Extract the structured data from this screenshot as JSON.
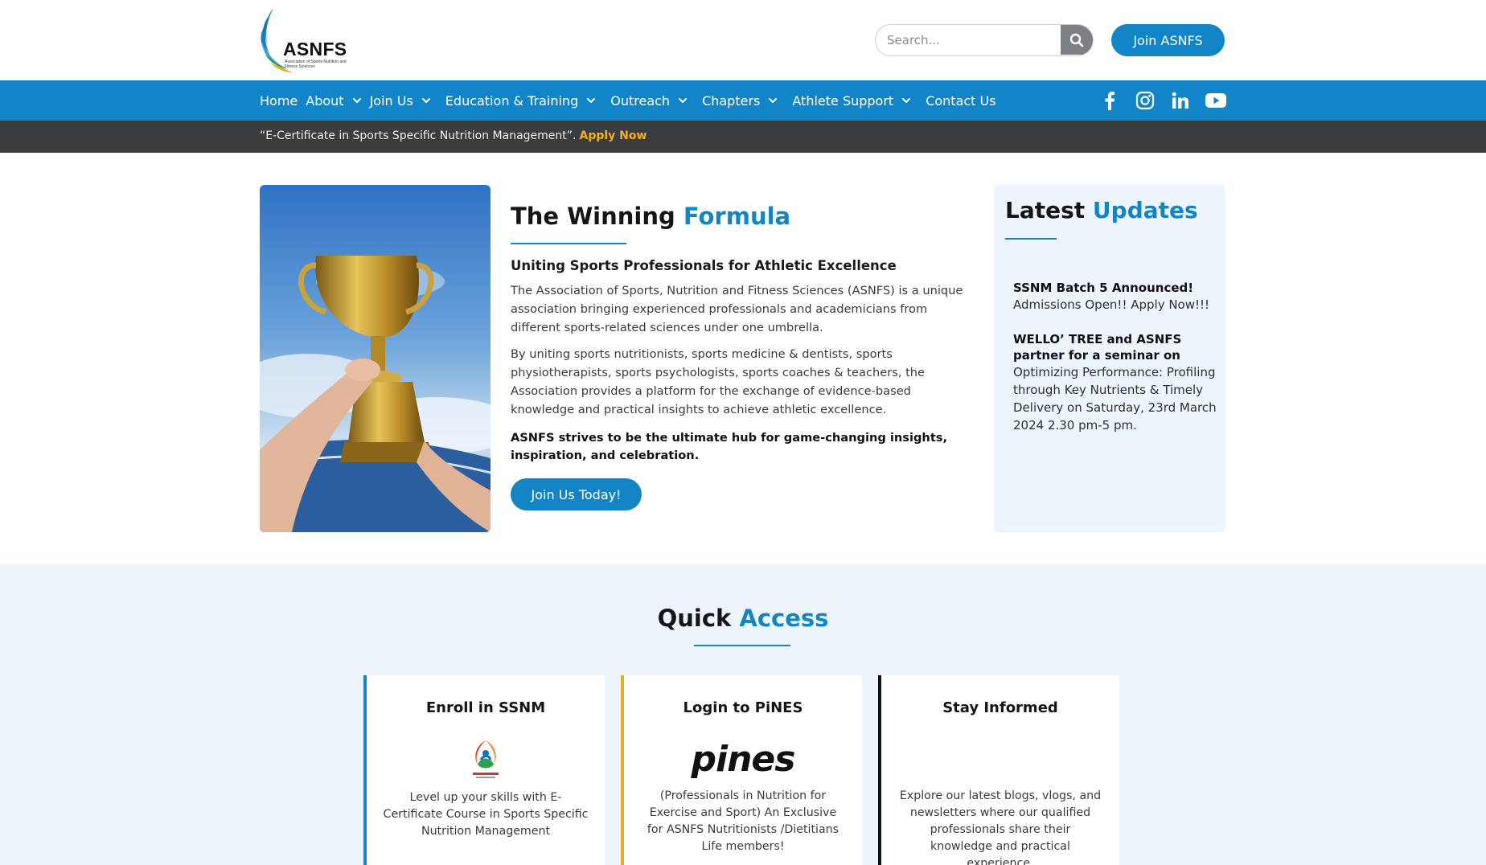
{
  "header": {
    "logo_text": "ASNFS",
    "logo_subtext": "Association of Sports Nutrition and Fitness Sciences",
    "search_placeholder": "Search...",
    "join_label": "Join ASNFS"
  },
  "nav": {
    "items": [
      {
        "label": "Home",
        "has_dropdown": false
      },
      {
        "label": "About",
        "has_dropdown": true
      },
      {
        "label": "Join Us",
        "has_dropdown": true
      },
      {
        "label": "Education & Training",
        "has_dropdown": true
      },
      {
        "label": "Outreach",
        "has_dropdown": true
      },
      {
        "label": "Chapters",
        "has_dropdown": true
      },
      {
        "label": "Athlete Support",
        "has_dropdown": true
      },
      {
        "label": "Contact Us",
        "has_dropdown": false
      }
    ],
    "social_icons": [
      "facebook-icon",
      "instagram-icon",
      "linkedin-icon",
      "youtube-icon"
    ]
  },
  "announcement": {
    "text": "“E-Certificate in Sports Specific Nutrition Management”.",
    "link": "Apply Now"
  },
  "hero": {
    "title_plain": "The Winning",
    "title_accent": "Formula",
    "subheading": "Uniting Sports Professionals for Athletic Excellence",
    "paragraph_1": "The Association of Sports, Nutrition and Fitness Sciences (ASNFS) is a unique association bringing experienced professionals and academicians from different sports-related sciences under one umbrella.",
    "paragraph_2": "By uniting sports nutritionists, sports medicine & dentists, sports physiotherapists, sports psychologists, sports coaches & teachers, the Association provides a platform for the exchange of evidence-based knowledge and practical insights to achieve athletic excellence.",
    "paragraph_bold": "ASNFS strives to be the ultimate hub for game-changing insights, inspiration, and celebration.",
    "button_label": "Join Us Today!"
  },
  "updates": {
    "title_plain": "Latest",
    "title_accent": "Updates",
    "items": [
      {
        "title": "SSNM Batch 5 Announced!",
        "body": "Admissions Open!! Apply Now!!!"
      },
      {
        "title": "WELLO’ TREE and ASNFS partner for a seminar on",
        "body": "Optimizing Performance: Profiling through Key Nutrients & Timely Delivery on Saturday, 23rd March 2024 2.30 pm-5 pm."
      }
    ]
  },
  "quick_access": {
    "title_plain": "Quick",
    "title_accent": "Access",
    "cards": [
      {
        "title": "Enroll in SSNM",
        "icon": "ssnm-logo-icon",
        "description": "Level up your skills with E-Certificate Course in Sports Specific Nutrition Management",
        "accent_color": "#1485c4"
      },
      {
        "title": "Login to PiNES",
        "icon": "pines-logo-icon",
        "logo_text": "pines",
        "description": "(Professionals in Nutrition for Exercise and Sport) An Exclusive for ASNFS Nutritionists /Dietitians Life members!",
        "accent_color": "#e9a825"
      },
      {
        "title": "Stay Informed",
        "icon": "",
        "description": "Explore our latest blogs, vlogs, and newsletters where our qualified professionals share their knowledge and practical experience.",
        "accent_color": "#111111"
      }
    ]
  },
  "colors": {
    "brand_blue": "#1285c8",
    "announcement_bg": "#3a3d40",
    "apply_now": "#f5b21a",
    "section_bg": "#eef4fb"
  }
}
